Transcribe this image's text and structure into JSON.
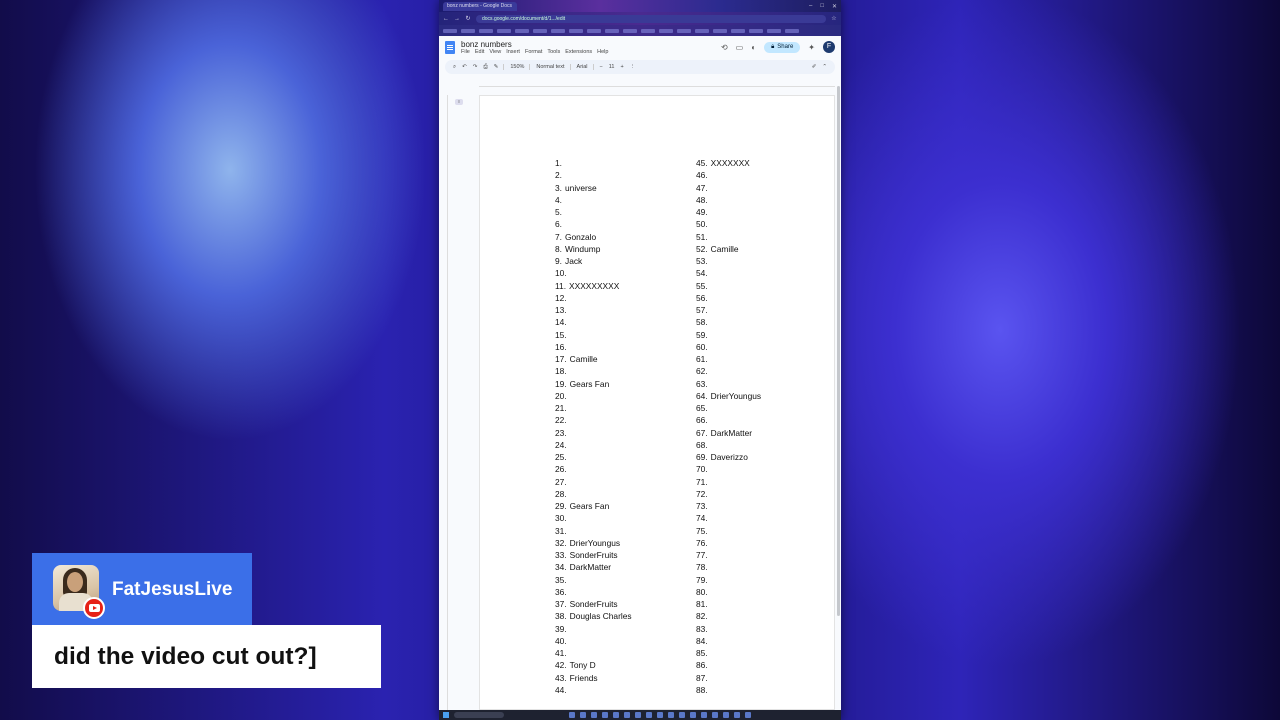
{
  "browser": {
    "tab_title": "bonz numbers - Google Docs",
    "url": "docs.google.com/document/d/1.../edit"
  },
  "doc": {
    "title": "bonz numbers",
    "menus": [
      "File",
      "Edit",
      "View",
      "Insert",
      "Format",
      "Tools",
      "Extensions",
      "Help"
    ],
    "share_label": "Share",
    "account_initial": "F",
    "zoom": "150%",
    "style": "Normal text",
    "font": "Arial",
    "font_size": "11"
  },
  "left_list": [
    {
      "num": "1.",
      "name": ""
    },
    {
      "num": "2.",
      "name": ""
    },
    {
      "num": "3.",
      "name": "universe"
    },
    {
      "num": "4.",
      "name": ""
    },
    {
      "num": "5.",
      "name": ""
    },
    {
      "num": "6.",
      "name": ""
    },
    {
      "num": "7.",
      "name": "Gonzalo"
    },
    {
      "num": "8.",
      "name": "Windump"
    },
    {
      "num": "9.",
      "name": "Jack"
    },
    {
      "num": "10.",
      "name": ""
    },
    {
      "num": "11.",
      "name": "XXXXXXXXX"
    },
    {
      "num": "12.",
      "name": ""
    },
    {
      "num": "13.",
      "name": ""
    },
    {
      "num": "14.",
      "name": ""
    },
    {
      "num": "15.",
      "name": ""
    },
    {
      "num": "16.",
      "name": ""
    },
    {
      "num": "17.",
      "name": "Camille"
    },
    {
      "num": "18.",
      "name": ""
    },
    {
      "num": "19.",
      "name": "Gears Fan"
    },
    {
      "num": "20.",
      "name": ""
    },
    {
      "num": "21.",
      "name": ""
    },
    {
      "num": "22.",
      "name": ""
    },
    {
      "num": "23.",
      "name": ""
    },
    {
      "num": "24.",
      "name": ""
    },
    {
      "num": "25.",
      "name": ""
    },
    {
      "num": "26.",
      "name": ""
    },
    {
      "num": "27.",
      "name": ""
    },
    {
      "num": "28.",
      "name": ""
    },
    {
      "num": "29.",
      "name": "Gears Fan"
    },
    {
      "num": "30.",
      "name": ""
    },
    {
      "num": "31.",
      "name": ""
    },
    {
      "num": "32.",
      "name": "DrierYoungus"
    },
    {
      "num": "33.",
      "name": "SonderFruits"
    },
    {
      "num": "34.",
      "name": "DarkMatter"
    },
    {
      "num": "35.",
      "name": ""
    },
    {
      "num": "36.",
      "name": ""
    },
    {
      "num": "37.",
      "name": "SonderFruits"
    },
    {
      "num": "38.",
      "name": "Douglas Charles"
    },
    {
      "num": "39.",
      "name": ""
    },
    {
      "num": "40.",
      "name": ""
    },
    {
      "num": "41.",
      "name": ""
    },
    {
      "num": "42.",
      "name": "Tony D"
    },
    {
      "num": "43.",
      "name": "Friends"
    },
    {
      "num": "44.",
      "name": ""
    }
  ],
  "right_list": [
    {
      "num": "45.",
      "name": "XXXXXXX"
    },
    {
      "num": "46.",
      "name": ""
    },
    {
      "num": "47.",
      "name": ""
    },
    {
      "num": "48.",
      "name": ""
    },
    {
      "num": "49.",
      "name": ""
    },
    {
      "num": "50.",
      "name": ""
    },
    {
      "num": "51.",
      "name": ""
    },
    {
      "num": "52.",
      "name": "Camille"
    },
    {
      "num": "53.",
      "name": ""
    },
    {
      "num": "54.",
      "name": ""
    },
    {
      "num": "55.",
      "name": ""
    },
    {
      "num": "56.",
      "name": ""
    },
    {
      "num": "57.",
      "name": ""
    },
    {
      "num": "58.",
      "name": ""
    },
    {
      "num": "59.",
      "name": ""
    },
    {
      "num": "60.",
      "name": ""
    },
    {
      "num": "61.",
      "name": ""
    },
    {
      "num": "62.",
      "name": ""
    },
    {
      "num": "63.",
      "name": ""
    },
    {
      "num": "64.",
      "name": "DrierYoungus"
    },
    {
      "num": "65.",
      "name": ""
    },
    {
      "num": "66.",
      "name": ""
    },
    {
      "num": "67.",
      "name": "DarkMatter"
    },
    {
      "num": "68.",
      "name": ""
    },
    {
      "num": "69.",
      "name": "Daverizzo"
    },
    {
      "num": "70.",
      "name": ""
    },
    {
      "num": "71.",
      "name": ""
    },
    {
      "num": "72.",
      "name": ""
    },
    {
      "num": "73.",
      "name": ""
    },
    {
      "num": "74.",
      "name": ""
    },
    {
      "num": "75.",
      "name": ""
    },
    {
      "num": "76.",
      "name": ""
    },
    {
      "num": "77.",
      "name": ""
    },
    {
      "num": "78.",
      "name": ""
    },
    {
      "num": "79.",
      "name": ""
    },
    {
      "num": "80.",
      "name": ""
    },
    {
      "num": "81.",
      "name": ""
    },
    {
      "num": "82.",
      "name": ""
    },
    {
      "num": "83.",
      "name": ""
    },
    {
      "num": "84.",
      "name": ""
    },
    {
      "num": "85.",
      "name": ""
    },
    {
      "num": "86.",
      "name": ""
    },
    {
      "num": "87.",
      "name": ""
    },
    {
      "num": "88.",
      "name": ""
    }
  ],
  "overlay": {
    "username": "FatJesusLive",
    "message": "did the video cut out?]"
  }
}
